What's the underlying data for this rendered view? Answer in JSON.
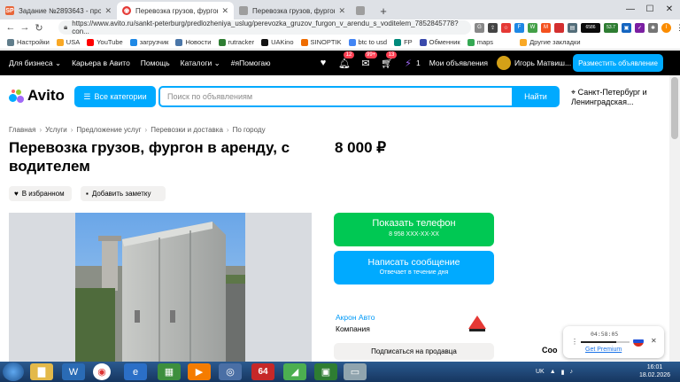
{
  "browser": {
    "tabs": [
      {
        "favicon": "SP",
        "title": "Задание №2893643 - просмотр з",
        "active": false,
        "color": "#e8663a"
      },
      {
        "favicon": "avito",
        "title": "Перевозка грузов, фургон в арен",
        "active": true,
        "color": "#e53935"
      },
      {
        "favicon": "page",
        "title": "Перевозка грузов, фургон в арен",
        "active": false,
        "color": "#9e9e9e"
      },
      {
        "favicon": "page",
        "title": "",
        "active": false,
        "color": "#9e9e9e"
      }
    ],
    "url": "https://www.avito.ru/sankt-peterburg/predlozheniya_uslug/perevozka_gruzov_furgon_v_arendu_s_voditelem_7852845778?con...",
    "ext_badges": {
      "ltc": "LTC",
      "price1": "6586",
      "price2": "53.7"
    },
    "bookmarks": [
      "Настройки",
      "USA",
      "YouTube",
      "загрузчик",
      "Новости",
      "rutracker",
      "UAKino",
      "SINOPTIK",
      "btc to usd",
      "FP",
      "Обменник",
      "maps",
      "Другие закладки"
    ]
  },
  "avito_nav": {
    "items": [
      "Для бизнеса ⌄",
      "Карьера в Авито",
      "Помощь",
      "Каталоги ⌄",
      "#яПомогаю"
    ],
    "badges": {
      "notifications": "12",
      "messages": "99+",
      "cart": "13"
    },
    "favorites_count": "1",
    "my_ads": "Мои объявления",
    "user": "Игорь Матвиш...",
    "place_ad": "Разместить объявление"
  },
  "header": {
    "logo": "Avito",
    "categories_button": "Все категории",
    "search_placeholder": "Поиск по объявлениям",
    "find_button": "Найти",
    "location": "Санкт-Петербург и Ленинградская..."
  },
  "breadcrumbs": [
    "Главная",
    "Услуги",
    "Предложение услуг",
    "Перевозки и доставка",
    "По городу"
  ],
  "listing": {
    "title": "Перевозка грузов, фургон в аренду, с водителем",
    "price": "8 000 ₽",
    "favorite_button": "В избранном",
    "note_button": "Добавить заметку"
  },
  "contact": {
    "phone_button": "Показать телефон",
    "phone_masked": "8 958 XXX-XX-XX",
    "message_button": "Написать сообщение",
    "message_sub": "Отвечает в течение дня",
    "seller_name": "Акрон Авто",
    "seller_type": "Компания",
    "subscribe_button": "Подписаться на продавца"
  },
  "overlay": {
    "timer": "04:58:05",
    "premium_link": "Get Premium",
    "cookie_text": "Coo"
  },
  "taskbar": {
    "lang": "UK",
    "time": "16:01",
    "date": "18.02.2026",
    "app_badge": "64"
  }
}
